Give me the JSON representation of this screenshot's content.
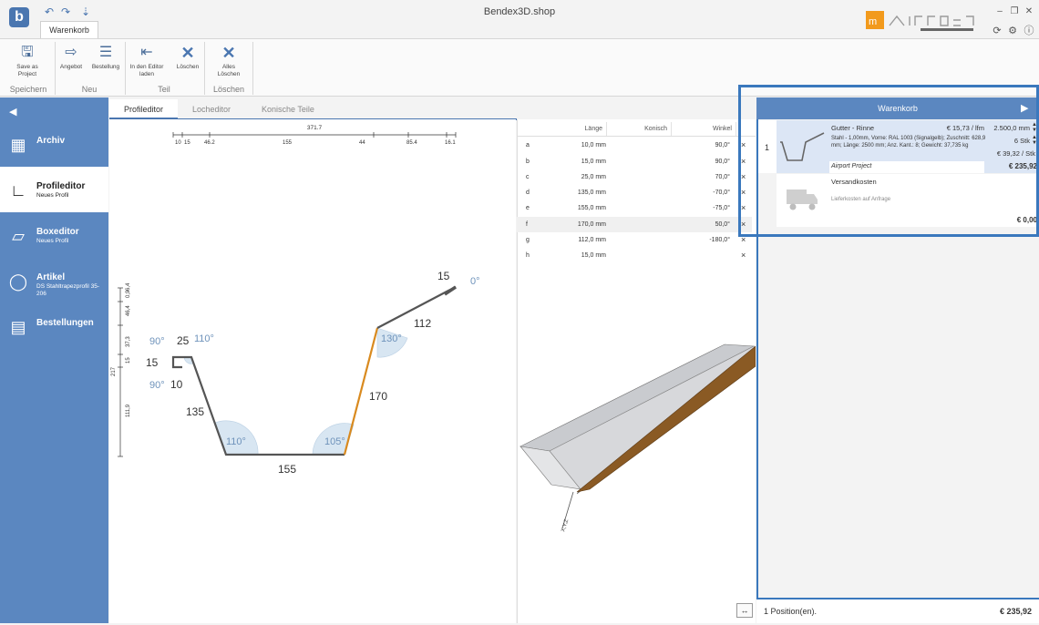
{
  "window": {
    "title": "Bendex3D.shop",
    "logo_letter": "b"
  },
  "ribbon": {
    "tab_label": "Warenkorb",
    "buttons": [
      {
        "label": "Save as Project",
        "icon": "floppy-icon"
      },
      {
        "label": "Angebot",
        "icon": "document-arrow-icon"
      },
      {
        "label": "Bestellung",
        "icon": "document-list-icon"
      },
      {
        "label": "In den Editor laden",
        "icon": "editor-load-icon"
      },
      {
        "label": "Löschen",
        "icon": "delete-icon"
      },
      {
        "label": "Alles Löschen",
        "icon": "delete-all-icon"
      }
    ],
    "groups": [
      "Speichern",
      "Neu",
      "Teil",
      "Löschen"
    ]
  },
  "sidebar": {
    "items": [
      {
        "label": "Archiv",
        "sub": ""
      },
      {
        "label": "Profileditor",
        "sub": "Neues Profil"
      },
      {
        "label": "Boxeditor",
        "sub": "Neues Profil"
      },
      {
        "label": "Artikel",
        "sub": "DS Stahltrapezprofil 35-206"
      },
      {
        "label": "Bestellungen",
        "sub": ""
      }
    ]
  },
  "editor": {
    "tabs": [
      "Profileditor",
      "Locheditor",
      "Konische Teile"
    ],
    "top_total": "371.7",
    "top_ticks": [
      "10",
      "15",
      "46.2",
      "155",
      "44",
      "85.4",
      "16.1"
    ],
    "left_total": "217",
    "left_ticks": [
      "0,9",
      "6,4",
      "46,4",
      "37,3",
      "15",
      "111,9"
    ],
    "labels": {
      "seg_a": "15",
      "seg_b": "25",
      "seg_c": "10",
      "seg_d": "135",
      "seg_e": "155",
      "seg_f": "170",
      "seg_g": "112",
      "seg_h": "15",
      "ang1": "90°",
      "ang2": "110°",
      "ang3": "90°",
      "ang4": "110°",
      "ang5": "105°",
      "ang6": "130°",
      "ang7": "0°"
    }
  },
  "table": {
    "headers": [
      "Länge",
      "Konisch",
      "Winkel"
    ],
    "rows": [
      {
        "id": "a",
        "length": "10,0 mm",
        "angle": "90,0°"
      },
      {
        "id": "b",
        "length": "15,0 mm",
        "angle": "90,0°"
      },
      {
        "id": "c",
        "length": "25,0 mm",
        "angle": "70,0°"
      },
      {
        "id": "d",
        "length": "135,0 mm",
        "angle": "-70,0°"
      },
      {
        "id": "e",
        "length": "155,0 mm",
        "angle": "-75,0°"
      },
      {
        "id": "f",
        "length": "170,0 mm",
        "angle": "50,0°"
      },
      {
        "id": "g",
        "length": "112,0 mm",
        "angle": "-180,0°"
      },
      {
        "id": "h",
        "length": "15,0 mm",
        "angle": ""
      }
    ],
    "remove_glyph": "×"
  },
  "view3d": {
    "axis_label": "X,Y,Z"
  },
  "cart": {
    "title": "Warenkorb",
    "item": {
      "pos": "1",
      "name": "Gutter - Rinne",
      "unit_price": "€ 15,73 / lfm",
      "length": "2.500,0 mm",
      "qty": "6 Stk",
      "price_per_piece": "€ 39,32 / Stk",
      "details": "Stahl - 1,00mm, Vorne: RAL 1003 (Signalgelb); Zuschnitt: 628,9 mm; Länge: 2500 mm; Anz. Kant.: 8; Gewicht: 37,735 kg",
      "project": "Airport Project",
      "total": "€ 235,92"
    },
    "shipping": {
      "name": "Versandkosten",
      "note": "Lieferkosten auf Anfrage",
      "total": "€ 0,00"
    },
    "footer": {
      "positions": "1 Position(en).",
      "total": "€ 235,92"
    }
  },
  "colors": {
    "accent": "#5b87c0",
    "highlight": "#3a78bd",
    "bend": "#d98a1f",
    "profile": "#555555"
  }
}
